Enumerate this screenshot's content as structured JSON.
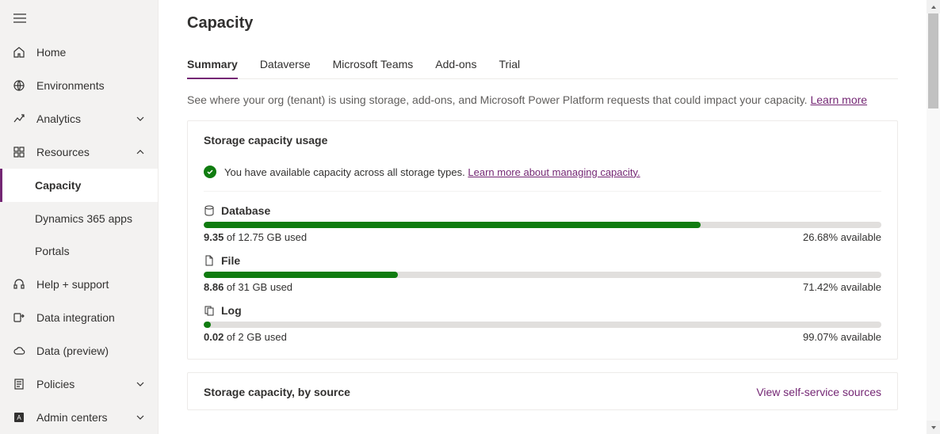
{
  "sidebar": {
    "items": [
      {
        "label": "Home"
      },
      {
        "label": "Environments"
      },
      {
        "label": "Analytics"
      },
      {
        "label": "Resources"
      },
      {
        "label": "Help + support"
      },
      {
        "label": "Data integration"
      },
      {
        "label": "Data (preview)"
      },
      {
        "label": "Policies"
      },
      {
        "label": "Admin centers"
      }
    ],
    "resourceChildren": [
      {
        "label": "Capacity"
      },
      {
        "label": "Dynamics 365 apps"
      },
      {
        "label": "Portals"
      }
    ]
  },
  "page": {
    "title": "Capacity",
    "tabs": [
      "Summary",
      "Dataverse",
      "Microsoft Teams",
      "Add-ons",
      "Trial"
    ],
    "introText": "See where your org (tenant) is using storage, add-ons, and Microsoft Power Platform requests that could impact your capacity. ",
    "introLink": "Learn more"
  },
  "usageCard": {
    "title": "Storage capacity usage",
    "infoText": "You have available capacity across all storage types. ",
    "infoLink": "Learn more about managing capacity.",
    "items": [
      {
        "name": "Database",
        "usedValue": "9.35",
        "totalText": " of 12.75 GB used",
        "availableText": "26.68% available",
        "fillPct": 73.3
      },
      {
        "name": "File",
        "usedValue": "8.86",
        "totalText": " of 31 GB used",
        "availableText": "71.42% available",
        "fillPct": 28.6
      },
      {
        "name": "Log",
        "usedValue": "0.02",
        "totalText": " of 2 GB used",
        "availableText": "99.07% available",
        "fillPct": 1.0
      }
    ]
  },
  "sourceCard": {
    "title": "Storage capacity, by source",
    "link": "View self-service sources"
  },
  "chart_data": [
    {
      "type": "bar",
      "title": "Database",
      "categories": [
        "used"
      ],
      "values": [
        9.35
      ],
      "ylim": [
        0,
        12.75
      ],
      "ylabel": "GB",
      "xlabel": ""
    },
    {
      "type": "bar",
      "title": "File",
      "categories": [
        "used"
      ],
      "values": [
        8.86
      ],
      "ylim": [
        0,
        31
      ],
      "ylabel": "GB",
      "xlabel": ""
    },
    {
      "type": "bar",
      "title": "Log",
      "categories": [
        "used"
      ],
      "values": [
        0.02
      ],
      "ylim": [
        0,
        2
      ],
      "ylabel": "GB",
      "xlabel": ""
    }
  ]
}
